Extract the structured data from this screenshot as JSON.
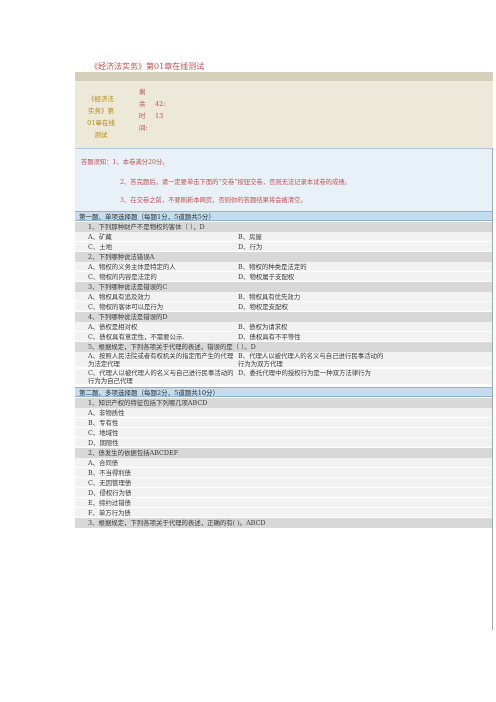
{
  "doc_title": "《经济法实务》第01章在线测试",
  "topbar": {
    "exam_name": "《经济法实务》第01章在线测试",
    "timer_label": "剩余时间:",
    "timer_min": "42:",
    "timer_sec": "13"
  },
  "notice": {
    "line1": "答题须知：1、本卷满分20分。",
    "line2": "2、答完题后，请一定要单击下面的“交卷”按钮交卷，否则无法记录本试卷的成绩。",
    "line3": "3、在交卷之前，不要刷新本网页，否则你的答题结果将会被清空。"
  },
  "section1": {
    "header": "第一题、单项选择题（每题1分，5道题共5分）",
    "q1": "1、下列那种财产不是物权的客体（   ），D",
    "q1a": "A、矿藏",
    "q1b": "B、房屋",
    "q1c": "C、土地",
    "q1d": "D、行为",
    "q2": "2、下列哪种说法错误A",
    "q2a": "A、物权的义务主体是特定的人",
    "q2b": "B、物权的种类是法定的",
    "q2c": "C、物权的内容是法定的",
    "q2d": "D、物权属于支配权",
    "q3": "3、下列哪种说法是错误的C",
    "q3a": "A、物权具有追及效力",
    "q3b": "B、物权具有优先效力",
    "q3c": "C、物权的客体可以是行为",
    "q3d": "D、物权是支配权",
    "q4": "4、下列哪种说法是错误的D",
    "q4a": "A、债权是相对权",
    "q4b": "B、债权为请求权",
    "q4c": "C、债权具有意定性，不需要公示.",
    "q4d": "D、债权具有不平等性",
    "q5": "5、根据规定，下列各项关于代理的表述，错误的是（ ）。D",
    "q5a": "A、按照人民法院或者有权机关的指定而产生的代理为法定代理",
    "q5b": "B、代理人以被代理人的名义与自己进行民事活动的行为为双方代理",
    "q5c": "C、代理人以被代理人的名义与自己进行民事活动的行为为自己代理",
    "q5d": "D、委托代理中的授权行为是一种双方法律行为"
  },
  "section2": {
    "header": "第二题、多项选择题（每题2分，5道题共10分）",
    "q1": "1、知识产权的特征包括下列哪几项ABCD",
    "q1a": "A、非物质性",
    "q1b": "B、专有性",
    "q1c": "C、地域性",
    "q1d": "D、期限性",
    "q2": "2、债发生的依据包括ABCDEF",
    "q2a": "A、合同债",
    "q2b": "B、不当得利债",
    "q2c": "C、无因管理债",
    "q2d": "D、侵权行为债",
    "q2e": "E、缔约过错债",
    "q2f": "F、单方行为债",
    "q3": "3、根据规定，下列各项关于代理的表述，正确的有(  )。ABCD"
  }
}
